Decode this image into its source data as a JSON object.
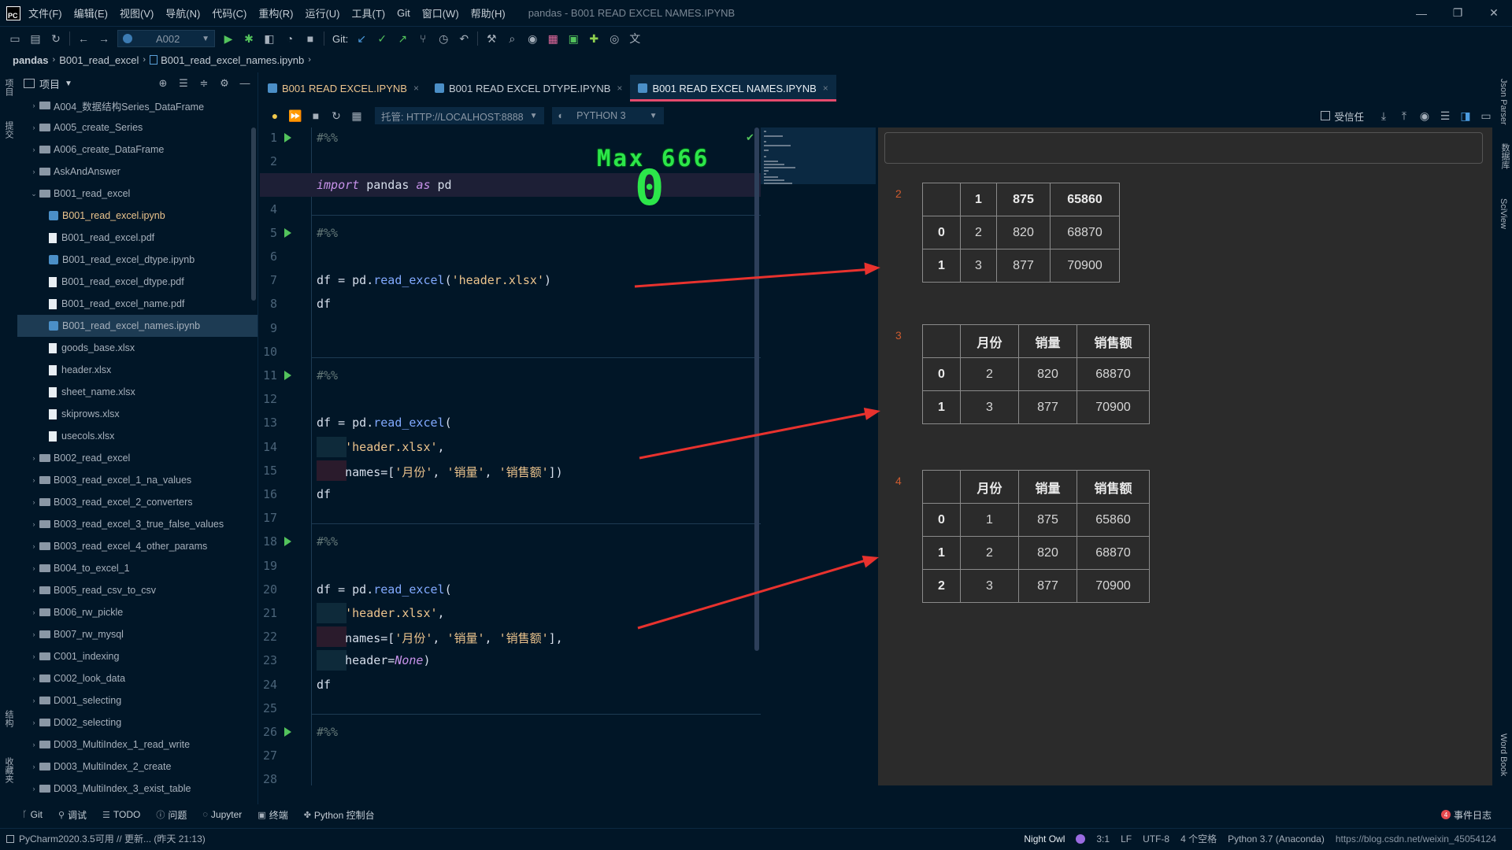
{
  "app": {
    "logo": "PC",
    "menu": [
      "文件(F)",
      "编辑(E)",
      "视图(V)",
      "导航(N)",
      "代码(C)",
      "重构(R)",
      "运行(U)",
      "工具(T)",
      "Git",
      "窗口(W)",
      "帮助(H)"
    ],
    "window_title": "pandas - B001 READ EXCEL NAMES.IPYNB",
    "window_buttons": [
      "—",
      "❐",
      "✕"
    ]
  },
  "toolbar": {
    "run_config": "A002",
    "git_label": "Git:"
  },
  "breadcrumb": [
    "pandas",
    "B001_read_excel",
    "B001_read_excel_names.ipynb"
  ],
  "left_strip": [
    "项目",
    "提交",
    "结构",
    "收藏夹"
  ],
  "right_strip": [
    "Json Parser",
    "数据库",
    "SciView",
    "Word Book"
  ],
  "project_panel": {
    "title": "项目",
    "items": [
      {
        "label": "A004_数据结构Series_DataFrame",
        "kind": "folder",
        "depth": 0,
        "expanded": false
      },
      {
        "label": "A005_create_Series",
        "kind": "folder",
        "depth": 0,
        "expanded": false
      },
      {
        "label": "A006_create_DataFrame",
        "kind": "folder",
        "depth": 0,
        "expanded": false
      },
      {
        "label": "AskAndAnswer",
        "kind": "folder",
        "depth": 0,
        "expanded": false
      },
      {
        "label": "B001_read_excel",
        "kind": "folder",
        "depth": 0,
        "expanded": true
      },
      {
        "label": "B001_read_excel.ipynb",
        "kind": "notebook",
        "depth": 1,
        "active": true
      },
      {
        "label": "B001_read_excel.pdf",
        "kind": "file",
        "depth": 1
      },
      {
        "label": "B001_read_excel_dtype.ipynb",
        "kind": "notebook",
        "depth": 1
      },
      {
        "label": "B001_read_excel_dtype.pdf",
        "kind": "file",
        "depth": 1
      },
      {
        "label": "B001_read_excel_name.pdf",
        "kind": "file",
        "depth": 1
      },
      {
        "label": "B001_read_excel_names.ipynb",
        "kind": "notebook",
        "depth": 1,
        "selected": true
      },
      {
        "label": "goods_base.xlsx",
        "kind": "file",
        "depth": 1
      },
      {
        "label": "header.xlsx",
        "kind": "file",
        "depth": 1
      },
      {
        "label": "sheet_name.xlsx",
        "kind": "file",
        "depth": 1
      },
      {
        "label": "skiprows.xlsx",
        "kind": "file",
        "depth": 1
      },
      {
        "label": "usecols.xlsx",
        "kind": "file",
        "depth": 1
      },
      {
        "label": "B002_read_excel",
        "kind": "folder",
        "depth": 0,
        "expanded": false
      },
      {
        "label": "B003_read_excel_1_na_values",
        "kind": "folder",
        "depth": 0,
        "expanded": false
      },
      {
        "label": "B003_read_excel_2_converters",
        "kind": "folder",
        "depth": 0,
        "expanded": false
      },
      {
        "label": "B003_read_excel_3_true_false_values",
        "kind": "folder",
        "depth": 0,
        "expanded": false
      },
      {
        "label": "B003_read_excel_4_other_params",
        "kind": "folder",
        "depth": 0,
        "expanded": false
      },
      {
        "label": "B004_to_excel_1",
        "kind": "folder",
        "depth": 0,
        "expanded": false
      },
      {
        "label": "B005_read_csv_to_csv",
        "kind": "folder",
        "depth": 0,
        "expanded": false
      },
      {
        "label": "B006_rw_pickle",
        "kind": "folder",
        "depth": 0,
        "expanded": false
      },
      {
        "label": "B007_rw_mysql",
        "kind": "folder",
        "depth": 0,
        "expanded": false
      },
      {
        "label": "C001_indexing",
        "kind": "folder",
        "depth": 0,
        "expanded": false
      },
      {
        "label": "C002_look_data",
        "kind": "folder",
        "depth": 0,
        "expanded": false
      },
      {
        "label": "D001_selecting",
        "kind": "folder",
        "depth": 0,
        "expanded": false
      },
      {
        "label": "D002_selecting",
        "kind": "folder",
        "depth": 0,
        "expanded": false
      },
      {
        "label": "D003_MultiIndex_1_read_write",
        "kind": "folder",
        "depth": 0,
        "expanded": false
      },
      {
        "label": "D003_MultiIndex_2_create",
        "kind": "folder",
        "depth": 0,
        "expanded": false
      },
      {
        "label": "D003_MultiIndex_3_exist_table",
        "kind": "folder",
        "depth": 0,
        "expanded": false
      }
    ]
  },
  "tabs": [
    {
      "label": "B001 READ EXCEL.IPYNB",
      "active": false
    },
    {
      "label": "B001 READ EXCEL DTYPE.IPYNB",
      "active": false
    },
    {
      "label": "B001 READ EXCEL NAMES.IPYNB",
      "active": true
    }
  ],
  "nb_toolbar": {
    "server_label": "托管: HTTP://LOCALHOST:8888",
    "kernel_label": "PYTHON 3",
    "trusted_label": "受信任"
  },
  "editor": {
    "current_line": 3,
    "run_lines": [
      1,
      5,
      11,
      18,
      26
    ],
    "lines": [
      {
        "n": 1,
        "text": "#%%"
      },
      {
        "n": 2,
        "text": ""
      },
      {
        "n": 3,
        "text": "import pandas as pd"
      },
      {
        "n": 4,
        "text": ""
      },
      {
        "n": 5,
        "text": "#%%"
      },
      {
        "n": 6,
        "text": ""
      },
      {
        "n": 7,
        "text": "df = pd.read_excel('header.xlsx')"
      },
      {
        "n": 8,
        "text": "df"
      },
      {
        "n": 9,
        "text": ""
      },
      {
        "n": 10,
        "text": ""
      },
      {
        "n": 11,
        "text": "#%%"
      },
      {
        "n": 12,
        "text": ""
      },
      {
        "n": 13,
        "text": "df = pd.read_excel("
      },
      {
        "n": 14,
        "text": "    'header.xlsx',"
      },
      {
        "n": 15,
        "text": "    names=['月份', '销量', '销售额'])"
      },
      {
        "n": 16,
        "text": "df"
      },
      {
        "n": 17,
        "text": ""
      },
      {
        "n": 18,
        "text": "#%%"
      },
      {
        "n": 19,
        "text": ""
      },
      {
        "n": 20,
        "text": "df = pd.read_excel("
      },
      {
        "n": 21,
        "text": "    'header.xlsx',"
      },
      {
        "n": 22,
        "text": "    names=['月份', '销量', '销售额'],"
      },
      {
        "n": 23,
        "text": "    header=None)"
      },
      {
        "n": 24,
        "text": "df"
      },
      {
        "n": 25,
        "text": ""
      },
      {
        "n": 26,
        "text": "#%%"
      },
      {
        "n": 27,
        "text": ""
      },
      {
        "n": 28,
        "text": ""
      }
    ]
  },
  "overlay": {
    "max_text": "Max 666",
    "zero_text": "0"
  },
  "outputs": [
    {
      "num": "2",
      "columns": [
        "",
        "1",
        "875",
        "65860"
      ],
      "rows": [
        [
          "0",
          "2",
          "820",
          "68870"
        ],
        [
          "1",
          "3",
          "877",
          "70900"
        ]
      ]
    },
    {
      "num": "3",
      "columns": [
        "",
        "月份",
        "销量",
        "销售额"
      ],
      "rows": [
        [
          "0",
          "2",
          "820",
          "68870"
        ],
        [
          "1",
          "3",
          "877",
          "70900"
        ]
      ]
    },
    {
      "num": "4",
      "columns": [
        "",
        "月份",
        "销量",
        "销售额"
      ],
      "rows": [
        [
          "0",
          "1",
          "875",
          "65860"
        ],
        [
          "1",
          "2",
          "820",
          "68870"
        ],
        [
          "2",
          "3",
          "877",
          "70900"
        ]
      ]
    }
  ],
  "bottom_tabs": [
    {
      "icon": "git-icon",
      "glyph": "ᚴ",
      "label": "Git"
    },
    {
      "icon": "debug-icon",
      "glyph": "⚲",
      "label": "调试"
    },
    {
      "icon": "todo-icon",
      "glyph": "☰",
      "label": "TODO"
    },
    {
      "icon": "problems-icon",
      "glyph": "ⓘ",
      "label": "问题"
    },
    {
      "icon": "jupyter-icon",
      "glyph": "◌",
      "label": "Jupyter"
    },
    {
      "icon": "terminal-icon",
      "glyph": "▣",
      "label": "终端"
    },
    {
      "icon": "python-console-icon",
      "glyph": "✤",
      "label": "Python 控制台"
    }
  ],
  "event_log": {
    "badge": "4",
    "label": "事件日志"
  },
  "status": {
    "message": "PyCharm2020.3.5可用 // 更新... (昨天 21:13)",
    "theme": "Night Owl",
    "position": "3:1",
    "line_sep": "LF",
    "encoding": "UTF-8",
    "indent": "4 个空格",
    "interpreter": "Python 3.7 (Anaconda)",
    "watermark": "https://blog.csdn.net/weixin_45054124"
  },
  "colors": {
    "bg": "#011627",
    "accent_tab": "#e64a6c",
    "run_green": "#53c35c",
    "overlay_green": "#2ce64a",
    "arrow_red": "#e8322e",
    "output_bg": "#2b2b2b"
  }
}
